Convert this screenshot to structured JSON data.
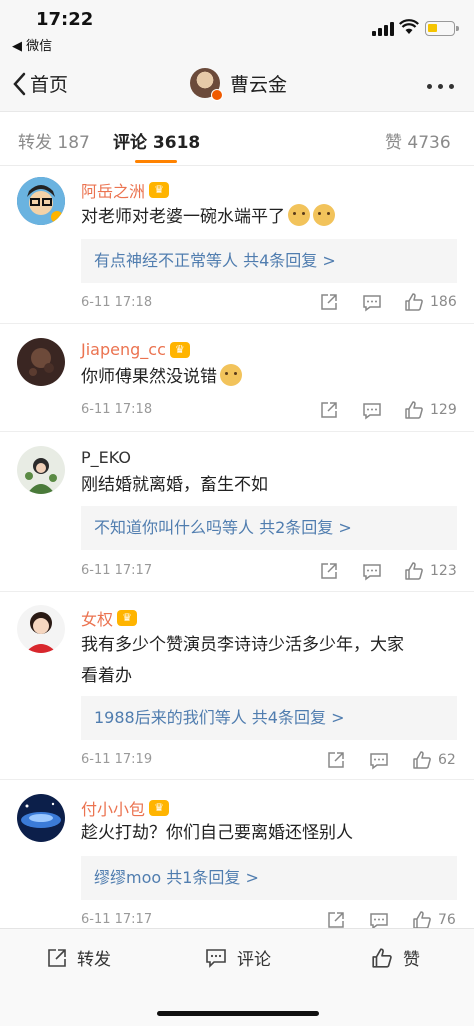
{
  "status": {
    "time": "17:22",
    "back_app": "◀ 微信"
  },
  "nav": {
    "back_label": "首页",
    "title": "曹云金"
  },
  "tabs": {
    "repost": "转发 187",
    "comment": "评论 3618",
    "like": "赞 4736"
  },
  "comments": [
    {
      "name": "阿岳之洲",
      "text": "对老师对老婆一碗水端平了",
      "reply": "有点神经不正常等人  共4条回复 >",
      "time": "6-11 17:18",
      "likes": "186"
    },
    {
      "name": "Jiapeng_cc",
      "text": "你师傅果然没说错",
      "time": "6-11 17:18",
      "likes": "129"
    },
    {
      "name": "P_EKO",
      "text": "刚结婚就离婚，畜生不如",
      "reply": "不知道你叫什么吗等人  共2条回复 >",
      "time": "6-11 17:17",
      "likes": "123"
    },
    {
      "name": "女权",
      "text_line1": "我有多少个赞演员李诗诗少活多少年，大家",
      "text_line2": "看着办",
      "reply": "1988后来的我们等人  共4条回复 >",
      "time": "6-11 17:19",
      "likes": "62"
    },
    {
      "name": "付小小包",
      "text": "趁火打劫？你们自己要离婚还怪别人",
      "reply": "缪缪moo  共1条回复 >",
      "time": "6-11 17:17",
      "likes": "76"
    }
  ],
  "bottom": {
    "repost": "转发",
    "comment": "评论",
    "like": "赞"
  }
}
